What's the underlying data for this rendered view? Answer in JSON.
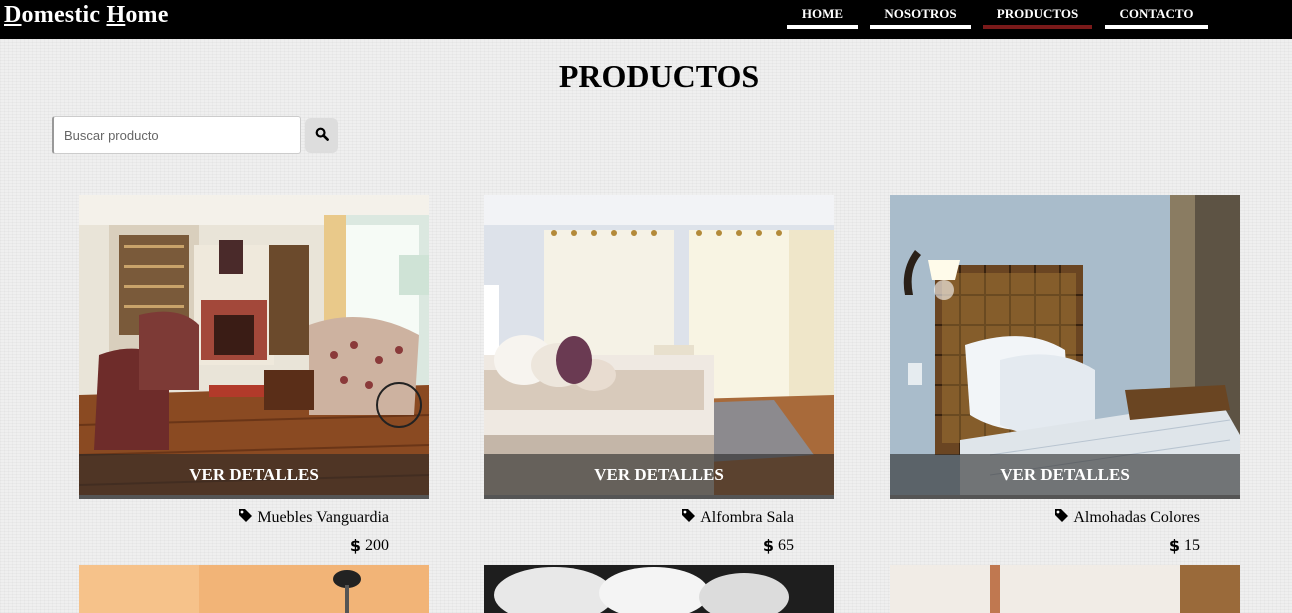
{
  "brand": {
    "first_initial": "D",
    "first_rest": "omestic ",
    "second_initial": "H",
    "second_rest": "ome"
  },
  "nav": [
    {
      "label": "HOME",
      "active": false
    },
    {
      "label": "NOSOTROS",
      "active": false
    },
    {
      "label": "PRODUCTOS",
      "active": true
    },
    {
      "label": "CONTACTO",
      "active": false
    }
  ],
  "page_title": "PRODUCTOS",
  "search": {
    "placeholder": "Buscar producto",
    "value": "",
    "button_icon": "search-icon"
  },
  "products": [
    {
      "overlay_label": "VER DETALLES",
      "name": "Muebles Vanguardia",
      "price": "200",
      "tag_icon": "tag-icon",
      "price_icon": "dollar-icon"
    },
    {
      "overlay_label": "VER DETALLES",
      "name": "Alfombra Sala",
      "price": "65",
      "tag_icon": "tag-icon",
      "price_icon": "dollar-icon"
    },
    {
      "overlay_label": "VER DETALLES",
      "name": "Almohadas Colores",
      "price": "15",
      "tag_icon": "tag-icon",
      "price_icon": "dollar-icon"
    }
  ],
  "colors": {
    "header_bg": "#000000",
    "active_underline": "#7a1a1a",
    "overlay_bg": "#282828"
  }
}
